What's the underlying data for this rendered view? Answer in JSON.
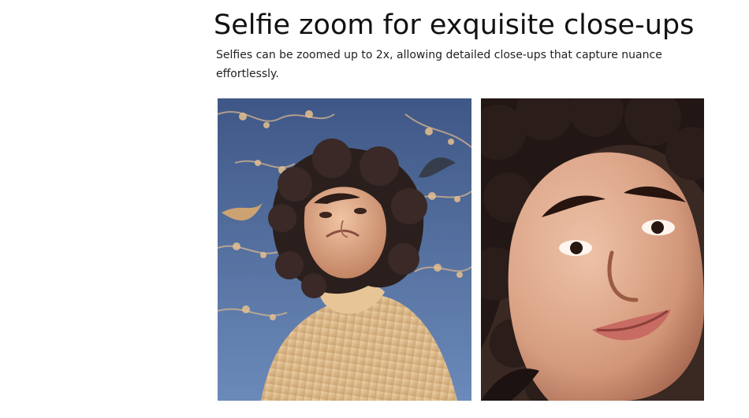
{
  "heading": "Selfie zoom for exquisite close-ups",
  "description": "Selfies can be zoomed up to 2x, allowing detailed close-ups that capture nuance effortlessly.",
  "images": {
    "left": {
      "subject": "woman-selfie-wide",
      "background_color": "#5c79a8",
      "sweater_color": "#d9b98b",
      "hair_color": "#2a1f1d",
      "skin_color": "#d6a080"
    },
    "right": {
      "subject": "woman-selfie-zoomed",
      "background_color": "#4a302a",
      "hair_color": "#1f1715",
      "skin_color": "#dda583"
    }
  }
}
